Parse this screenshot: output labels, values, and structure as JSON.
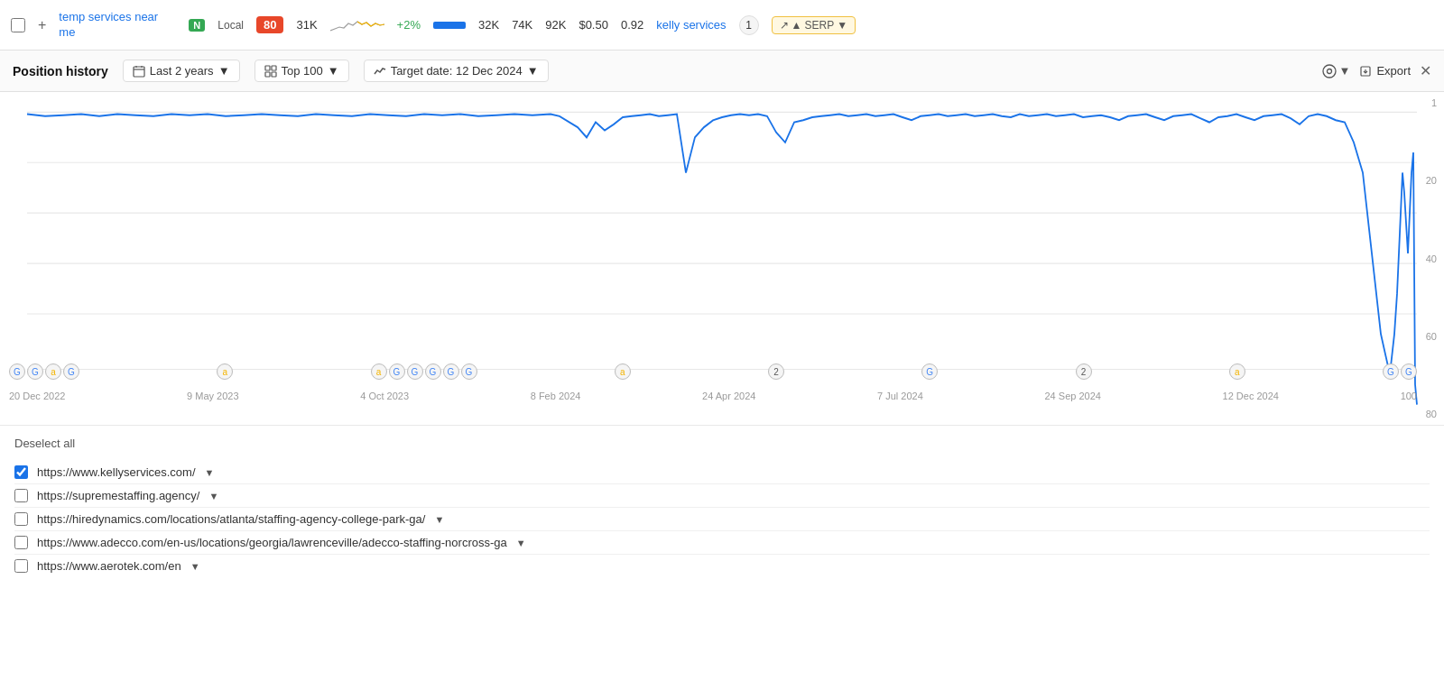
{
  "topRow": {
    "keyword": "temp services near me",
    "badge_n": "N",
    "badge_local": "Local",
    "score": "80",
    "stat1": "31K",
    "stat_change": "+2%",
    "stat2": "32K",
    "stat3": "74K",
    "stat4": "92K",
    "stat5": "$0.50",
    "stat6": "0.92",
    "keyword2": "kelly services",
    "badge_1": "1",
    "serp_label": "SERP"
  },
  "toolbar": {
    "title": "Position history",
    "date_range": "Last 2 years",
    "top_filter": "Top 100",
    "target_date": "Target date: 12 Dec 2024",
    "comment_label": "",
    "export_label": "Export"
  },
  "chart": {
    "y_labels": [
      "1",
      "20",
      "40",
      "60",
      "80",
      "100"
    ],
    "x_labels": [
      "20 Dec 2022",
      "9 May 2023",
      "4 Oct 2023",
      "8 Feb 2024",
      "24 Apr 2024",
      "7 Jul 2024",
      "24 Sep 2024",
      "12 Dec 2024"
    ]
  },
  "bottom": {
    "deselect_all": "Deselect all",
    "urls": [
      {
        "checked": true,
        "url": "https://www.kellyservices.com/"
      },
      {
        "checked": false,
        "url": "https://supremestaffing.agency/"
      },
      {
        "checked": false,
        "url": "https://hiredynamics.com/locations/atlanta/staffing-agency-college-park-ga/"
      },
      {
        "checked": false,
        "url": "https://www.adecco.com/en-us/locations/georgia/lawrenceville/adecco-staffing-norcross-ga"
      },
      {
        "checked": false,
        "url": "https://www.aerotek.com/en"
      }
    ]
  }
}
